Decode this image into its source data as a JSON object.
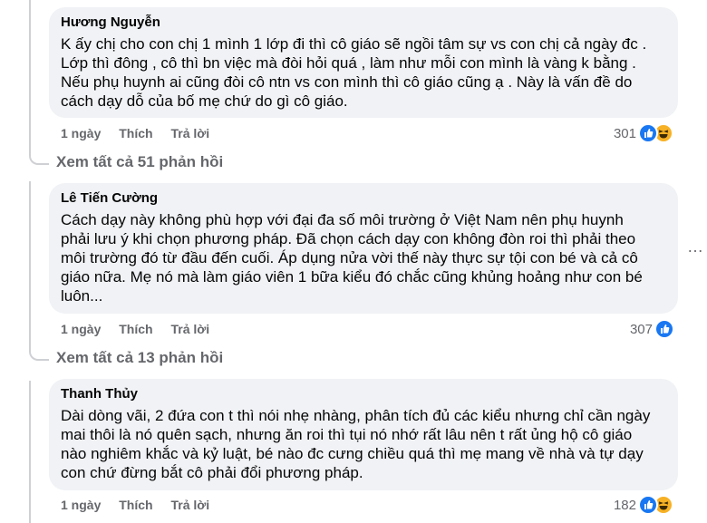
{
  "comments": [
    {
      "author": "Hương Nguyễn",
      "lines": [
        "K ấy chị cho con chị 1 mình 1 lớp đi thì cô giáo sẽ ngồi tâm sự vs con chị cả ngày đc .",
        "Lớp thì đông , cô thì bn việc mà đòi hỏi quá , làm như mỗi con mình là vàng k bằng .",
        "Nếu phụ huynh ai cũng đòi cô ntn vs con mình thì cô giáo cũng ạ . Này là vấn đề do",
        "cách dạy dỗ của bố mẹ chứ do gì cô giáo."
      ],
      "time": "1 ngày",
      "like_label": "Thích",
      "reply_label": "Trả lời",
      "reaction_count": "301",
      "reactions": [
        "like-icon",
        "haha-icon"
      ],
      "view_replies": "Xem tất cả 51 phản hồi"
    },
    {
      "author": "Lê Tiến Cường",
      "lines": [
        "Cách dạy này không phù hợp với đại đa số môi trường ở Việt Nam nên phụ huynh",
        "phải lưu ý khi chọn phương pháp. Đã chọn cách dạy con không đòn roi thì phải theo",
        "môi trường đó từ đầu đến cuối. Áp dụng nửa vời thế này thực sự tội con bé và cả cô",
        "giáo nữa. Mẹ nó mà làm giáo viên 1 bữa kiểu đó chắc cũng khủng hoảng như con bé",
        "luôn..."
      ],
      "time": "1 ngày",
      "like_label": "Thích",
      "reply_label": "Trả lời",
      "reaction_count": "307",
      "reactions": [
        "like-icon"
      ],
      "view_replies": "Xem tất cả 13 phản hồi"
    },
    {
      "author": "Thanh Thủy",
      "lines": [
        "Dài dòng vãi, 2 đứa con t thì nói nhẹ nhàng, phân tích đủ các kiểu nhưng chỉ cần ngày",
        "mai thôi là nó quên sạch, nhưng ăn roi thì tụi nó nhớ rất lâu nên t rất ủng hộ cô giáo",
        "nào nghiêm khắc và kỷ luật, bé nào đc cưng chiều quá thì mẹ mang về nhà và tự dạy",
        "con chứ đừng bắt cô phải đổi phương pháp."
      ],
      "time": "1 ngày",
      "like_label": "Thích",
      "reply_label": "Trả lời",
      "reaction_count": "182",
      "reactions": [
        "like-icon",
        "haha-icon"
      ]
    }
  ],
  "more_icon": "…",
  "colors": {
    "bubble": "#f0f2f5",
    "like": "#1877f2",
    "haha": "#f7b125",
    "muted": "#65676b"
  }
}
